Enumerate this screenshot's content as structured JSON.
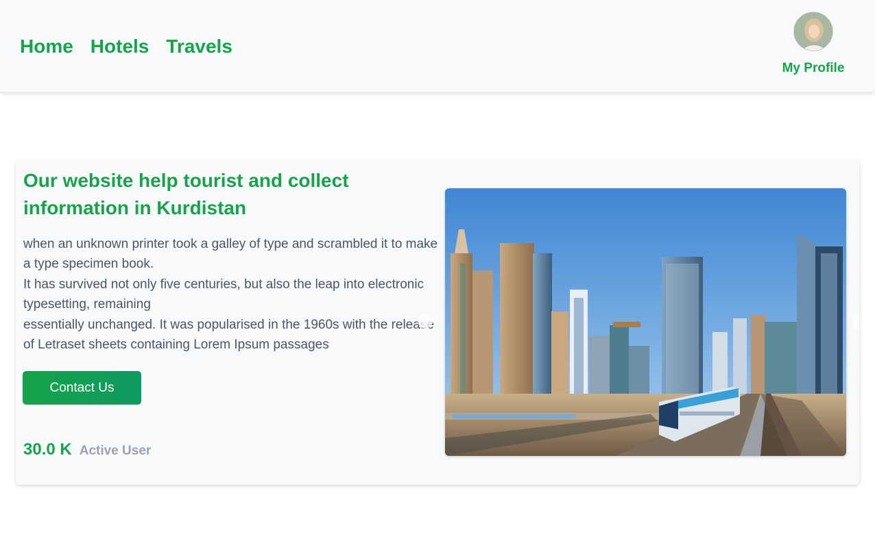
{
  "nav": {
    "links": [
      "Home",
      "Hotels",
      "Travels"
    ],
    "profile_label": "My Profile"
  },
  "hero": {
    "title": "Our website help tourist and collect information in Kurdistan",
    "body_lines": [
      "when an unknown printer took a galley of type and scrambled it to make a type specimen book.",
      "It has survived not only five centuries, but also the leap into electronic typesetting, remaining",
      "essentially unchanged. It was popularised in the 1960s with the release of Letraset sheets containing Lorem Ipsum passages"
    ],
    "button_label": "Contact Us",
    "stat_value": "30.0 K",
    "stat_label": "Active User"
  },
  "icons": {
    "avatar": "user-avatar-photo",
    "carousel_prev": "chevron-left-icon",
    "carousel_next": "chevron-right-icon"
  },
  "colors": {
    "brand": "#16a34a",
    "nav_bg": "#f8f9fa",
    "body_text": "#4b5563",
    "muted": "#9ca3af"
  }
}
